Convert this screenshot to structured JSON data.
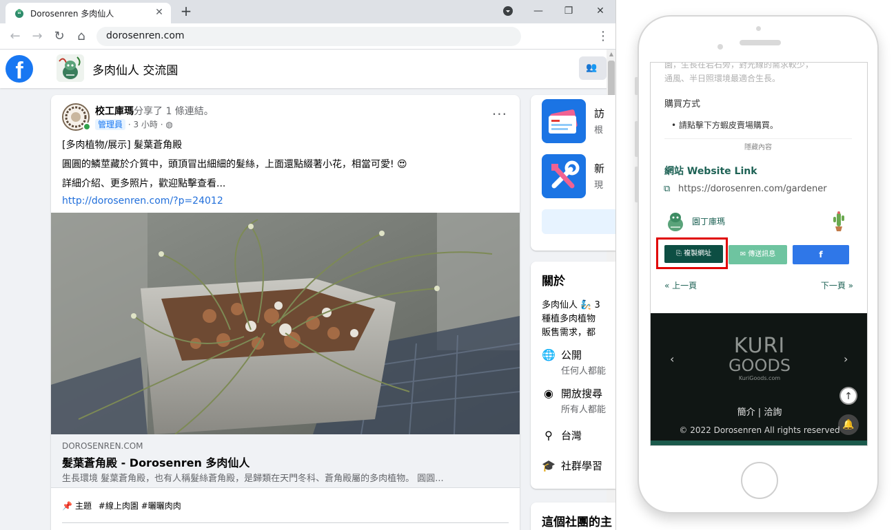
{
  "browser": {
    "tab_title": "Dorosenren 多肉仙人",
    "tab_close": "✕",
    "new_tab": "+",
    "url": "dorosenren.com",
    "back": "←",
    "forward": "→",
    "reload": "↻",
    "home": "⌂",
    "menu": "⋮",
    "win_profile": "▾",
    "win_min": "—",
    "win_max": "❐",
    "win_close": "✕"
  },
  "facebook": {
    "logo_letter": "f",
    "group_name": "多肉仙人 交流園",
    "group_button_icon": "people-icon",
    "post": {
      "author": "校工庫瑪",
      "action": "分享了 1 條連結。",
      "role": "管理員",
      "time": "· 3 小時 ·",
      "privacy_icon": "globe-icon",
      "more": "···",
      "line1": "[多肉植物/展示] 髮葉蒼角殿",
      "line2": "圓圓的鱗莖藏於介質中，頭頂冒出細細的髮絲，上面還點綴著小花，相當可愛! 😍",
      "line3": "詳細介紹、更多照片，歡迎點擊查看...",
      "link": "http://dorosenren.com/?p=24012",
      "preview_domain": "DOROSENREN.COM",
      "preview_title": "髮葉蒼角殿 - Dorosenren 多肉仙人",
      "preview_desc": "生長環境 髮葉蒼角殿，也有人稱髮絲蒼角殿，是歸類在天門冬科、蒼角殿屬的多肉植物。 圓圓...",
      "topics_label": "主題",
      "topics_tags": "#線上肉園 #曬曬肉肉"
    },
    "sidebar": {
      "item1_title": "訪",
      "item1_sub": "根",
      "item2_title": "新",
      "item2_sub": "現",
      "about_title": "關於",
      "about_line1": "多肉仙人 🧞 3",
      "about_line2": "種植多肉植物",
      "about_line3": "販售需求，都",
      "public_title": "公開",
      "public_sub": "任何人都能",
      "search_title": "開放搜尋",
      "search_sub": "所有人都能",
      "location": "台灣",
      "learning": "社群學習",
      "card3_title": "這個社團的主"
    }
  },
  "phone": {
    "faded_line1": "園，生長在岩石旁，對光線的需求較少，",
    "faded_line2": "通風、半日照環境最適合生長。",
    "buy_heading": "購買方式",
    "buy_item": "請點擊下方蝦皮賣場購買。",
    "hidden_content": "隱藏內容",
    "website_heading": "網站 Website Link",
    "website_url": "https://dorosenren.com/gardener",
    "gardener_name": "園丁庫瑪",
    "copy_button": "複製網址",
    "message_button": "傳送訊息",
    "fb_button": "f",
    "prev_page": "« 上一頁",
    "next_page": "下一頁 »",
    "footer_logo_line1": "KURI",
    "footer_logo_line2": "GOODS",
    "footer_logo_line3": "KuriGoods.com",
    "footer_left_arrow": "‹",
    "footer_right_arrow": "›",
    "footer_links": "簡介  |  洽詢",
    "copyright": "© 2022 Dorosenren All rights reserved",
    "scroll_top": "↑",
    "bell": "🔔"
  },
  "colors": {
    "facebook_blue": "#1877f2",
    "site_green": "#0d4e43",
    "highlight_red": "#e00000"
  }
}
